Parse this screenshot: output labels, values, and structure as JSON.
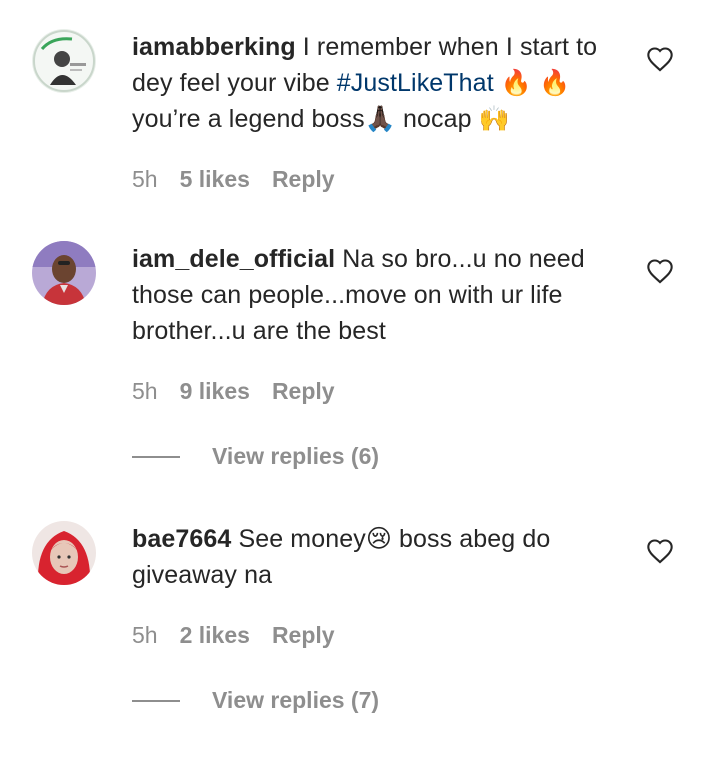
{
  "comments": [
    {
      "username": "iamabberking",
      "text_before": " I remember when I start to dey feel your vibe ",
      "hashtag": "#JustLikeThat",
      "text_after": " 🔥 🔥 you’re a legend boss🙏🏿 nocap 🙌",
      "time": "5h",
      "likes": "5 likes",
      "reply": "Reply",
      "avatar_icon": "profile-photo-man-green-logo"
    },
    {
      "username": "iam_dele_official",
      "text_before": " Na so bro...u no need those can people...move on with ur life brother...u are the best",
      "time": "5h",
      "likes": "9 likes",
      "reply": "Reply",
      "view_replies": "View replies (6)",
      "avatar_icon": "profile-photo-man-red-shirt"
    },
    {
      "username": "bae7664",
      "text_before": " See money😢 boss abeg do giveaway na",
      "time": "5h",
      "likes": "2 likes",
      "reply": "Reply",
      "view_replies": "View replies (7)",
      "avatar_icon": "profile-photo-woman-red-hair"
    }
  ],
  "colors": {
    "text": "#262626",
    "secondary": "#8e8e8e",
    "hashtag": "#00376b",
    "background": "#ffffff"
  },
  "icons": {
    "like": "heart-outline-icon"
  }
}
